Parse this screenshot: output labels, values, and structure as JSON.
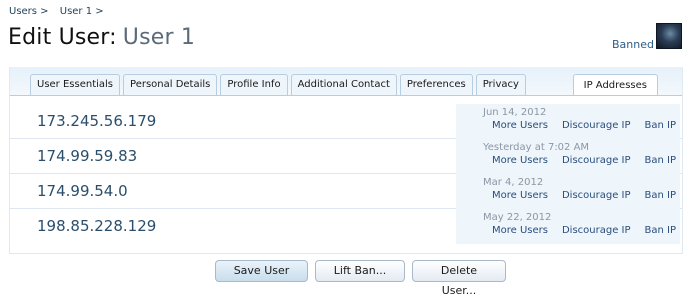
{
  "breadcrumb": [
    "Users >",
    "User 1 >"
  ],
  "title": {
    "prefix": "Edit User:",
    "username": "User 1"
  },
  "status": {
    "banned_label": "Banned"
  },
  "tabs": [
    "User Essentials",
    "Personal Details",
    "Profile Info",
    "Additional Contact",
    "Preferences",
    "Privacy"
  ],
  "active_tab": "IP Addresses",
  "ip_rows": [
    {
      "ip": "173.245.56.179",
      "date": "Jun 14, 2012",
      "actions": [
        "More Users",
        "Discourage IP",
        "Ban IP"
      ]
    },
    {
      "ip": "174.99.59.83",
      "date": "Yesterday at 7:02 AM",
      "actions": [
        "More Users",
        "Discourage IP",
        "Ban IP"
      ]
    },
    {
      "ip": "174.99.54.0",
      "date": "Mar 4, 2012",
      "actions": [
        "More Users",
        "Discourage IP",
        "Ban IP"
      ]
    },
    {
      "ip": "198.85.228.129",
      "date": "May 22, 2012",
      "actions": [
        "More Users",
        "Discourage IP",
        "Ban IP"
      ]
    }
  ],
  "buttons": {
    "save": "Save User",
    "lift_ban": "Lift Ban...",
    "delete": "Delete User..."
  }
}
